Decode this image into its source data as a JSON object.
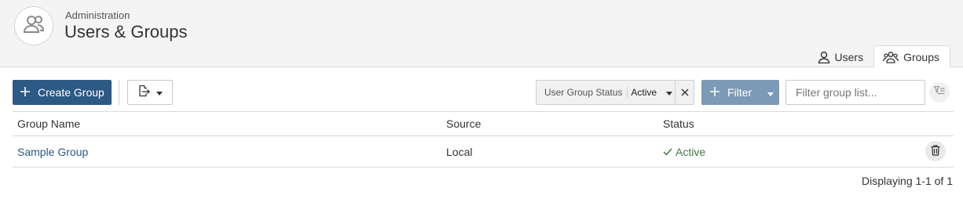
{
  "header": {
    "breadcrumb": "Administration",
    "title": "Users & Groups",
    "avatar_icon": "users-icon"
  },
  "tabs": [
    {
      "label": "Users",
      "icon": "user-icon",
      "active": false
    },
    {
      "label": "Groups",
      "icon": "users-icon",
      "active": true
    }
  ],
  "toolbar": {
    "create_label": "Create Group",
    "create_icon": "plus-icon",
    "export_icon": "export-icon",
    "status_filter": {
      "label": "User Group Status",
      "value": "Active"
    },
    "filter_label": "Filter",
    "search_placeholder": "Filter group list..."
  },
  "table": {
    "columns": [
      "Group Name",
      "Source",
      "Status"
    ],
    "rows": [
      {
        "name": "Sample Group",
        "source": "Local",
        "status": "Active"
      }
    ]
  },
  "footer": {
    "displaying": "Displaying 1-1 of 1"
  },
  "colors": {
    "primary": "#2c5a85",
    "filter_button": "#7b9ab5",
    "status_active": "#3f7a3f",
    "header_bg": "#f4f4f4"
  }
}
